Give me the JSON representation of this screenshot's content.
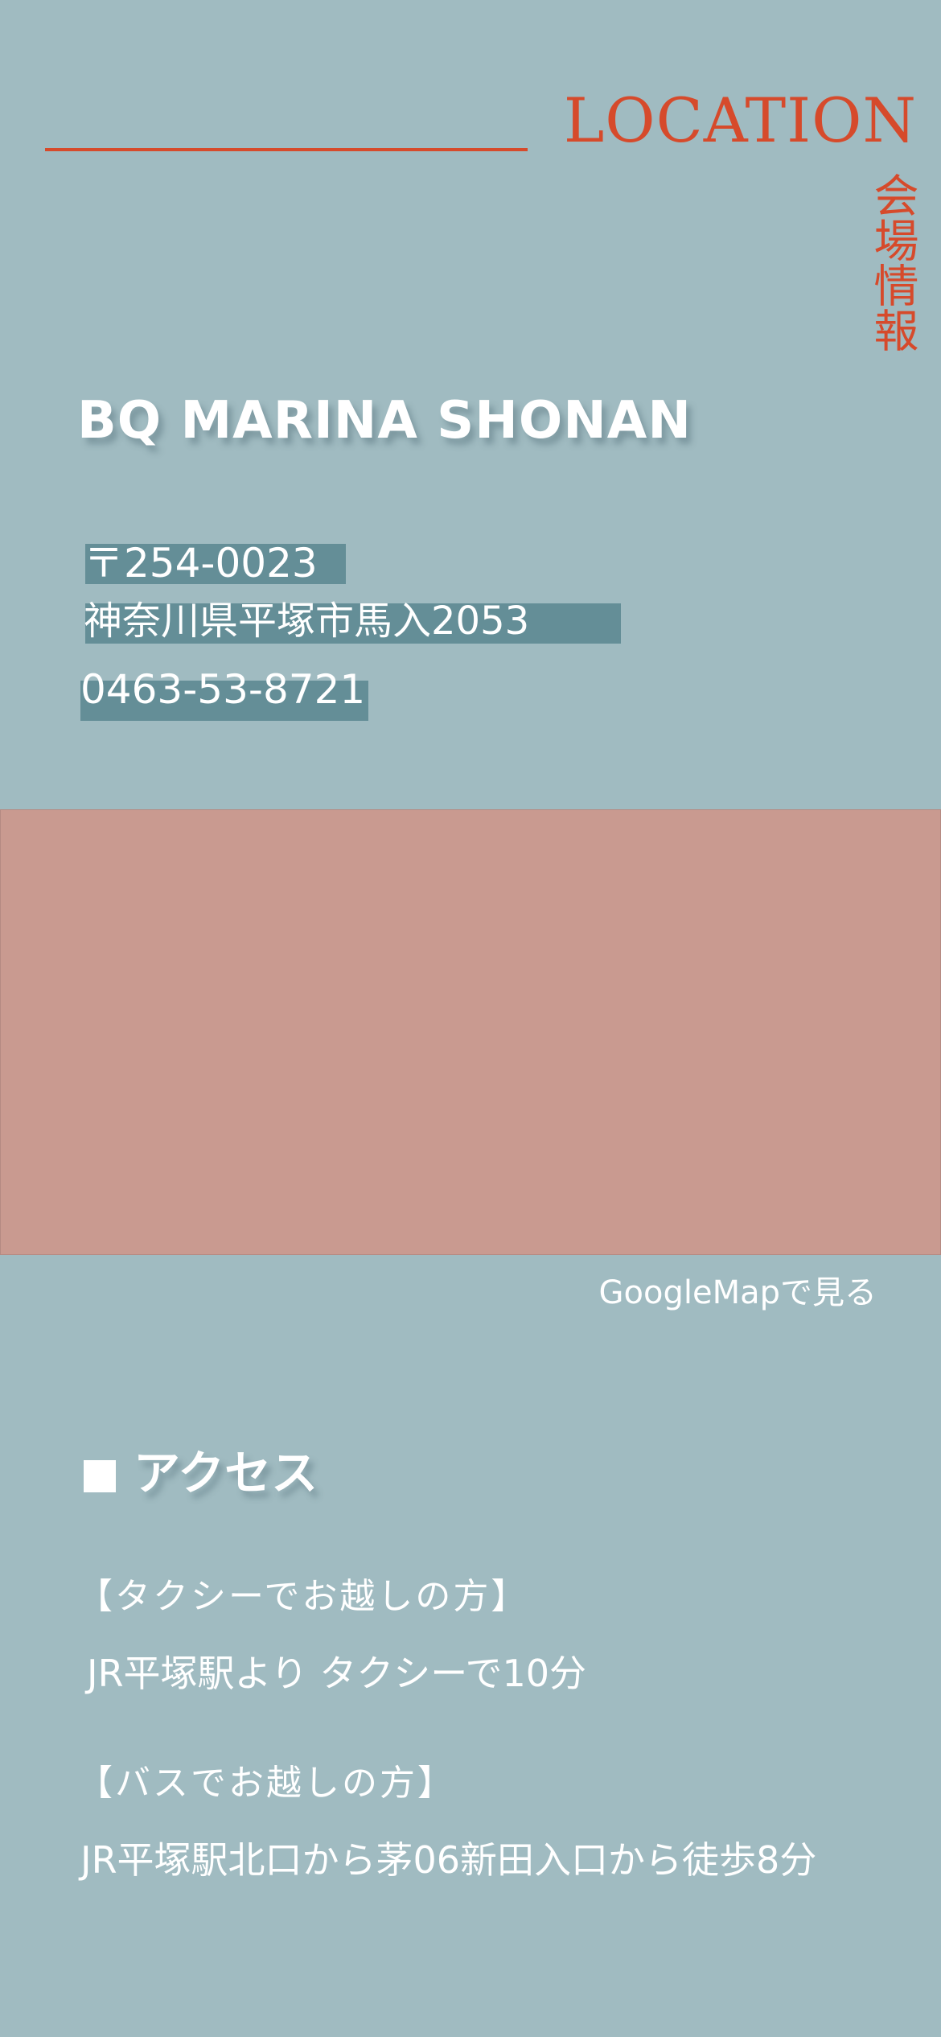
{
  "header": {
    "title": "LOCATION",
    "subtitle": "会場情報"
  },
  "venue": {
    "name": "BQ MARINA SHONAN",
    "postal": "〒254-0023",
    "address": "神奈川県平塚市馬入2053",
    "phone": "0463-53-8721"
  },
  "map": {
    "link_label": "GoogleMapで見る"
  },
  "access": {
    "heading": "アクセス",
    "taxi": {
      "title": "【タクシーでお越しの方】",
      "desc": "JR平塚駅より タクシーで10分"
    },
    "bus": {
      "title": "【バスでお越しの方】",
      "desc": "JR平塚駅北口から茅06新田入口から徒歩8分"
    }
  },
  "colors": {
    "background": "#a0bbc1",
    "accent": "#d64a2b",
    "highlight": "#648e97",
    "map": "#c99a90"
  }
}
